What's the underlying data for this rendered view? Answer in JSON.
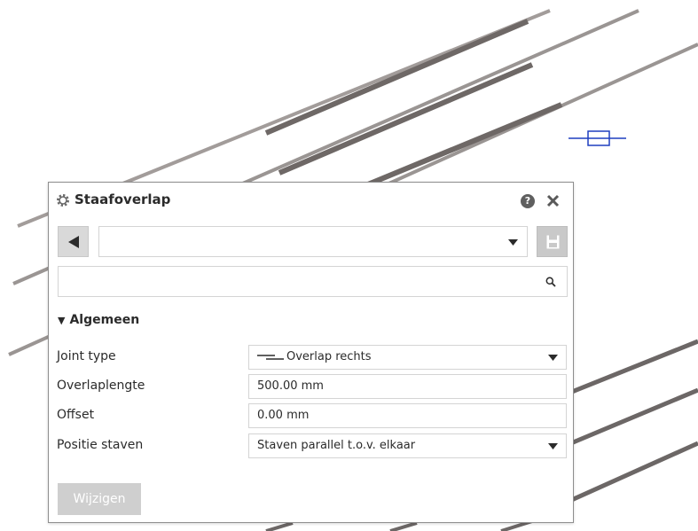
{
  "dialog": {
    "title": "Staafoverlap",
    "icons": {
      "settings": "gear-icon",
      "help": "help-icon",
      "close": "close-icon"
    },
    "help_glyph": "?"
  },
  "toolbar": {
    "preset_value": "",
    "search_value": ""
  },
  "section": {
    "title": "Algemeen",
    "collapse_glyph": "▼"
  },
  "properties": [
    {
      "label": "Joint type",
      "value": "Overlap rechts",
      "kind": "dropdown",
      "icon": "overlap-line-icon"
    },
    {
      "label": "Overlaplengte",
      "value": "500.00 mm",
      "kind": "text"
    },
    {
      "label": "Offset",
      "value": "0.00 mm",
      "kind": "text"
    },
    {
      "label": "Positie staven",
      "value": "Staven parallel t.o.v. elkaar",
      "kind": "dropdown"
    }
  ],
  "footer": {
    "apply_label": "Wijzigen",
    "apply_enabled": false
  },
  "colors": {
    "rebar": "#8f8f8f",
    "rebar_dark": "#5a5a5a",
    "marker": "#1f3fbf",
    "disabled_button": "#cfcfcf"
  }
}
